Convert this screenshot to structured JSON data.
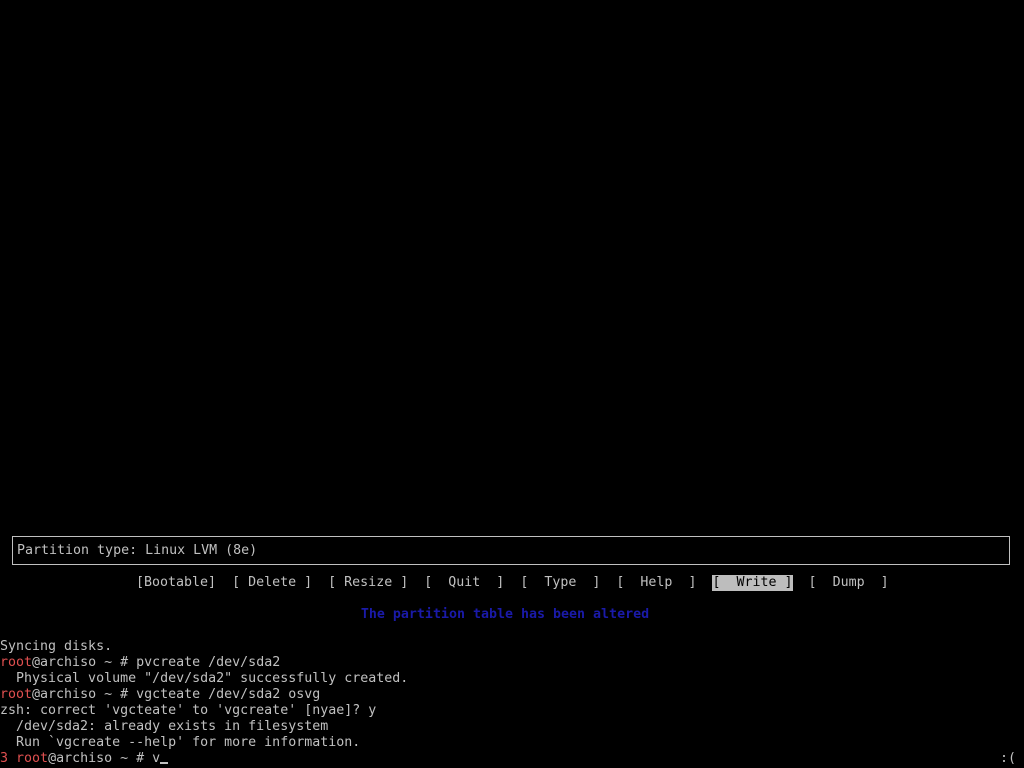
{
  "colors": {
    "background": "#000000",
    "foreground": "#c0c0c0",
    "root_user": "#e05050",
    "status_message": "#1a1aa8",
    "selected_button_bg": "#bdbdbd",
    "selected_button_fg": "#000000"
  },
  "cfdisk": {
    "partition_info": "Partition type: Linux LVM (8e)",
    "menu": [
      {
        "label": "[Bootable]",
        "selected": false
      },
      {
        "label": "[ Delete ]",
        "selected": false
      },
      {
        "label": "[ Resize ]",
        "selected": false
      },
      {
        "label": "[  Quit  ]",
        "selected": false
      },
      {
        "label": "[  Type  ]",
        "selected": false
      },
      {
        "label": "[  Help  ]",
        "selected": false
      },
      {
        "label": "[  Write ]",
        "selected": true
      },
      {
        "label": "[  Dump  ]",
        "selected": false
      }
    ],
    "status_message": "The partition table has been altered"
  },
  "terminal": {
    "syncing": "Syncing disks.",
    "prompt_user": "root",
    "prompt_host": "@archiso ~ # ",
    "cmd1": "pvcreate /dev/sda2",
    "out1": "  Physical volume \"/dev/sda2\" successfully created.",
    "cmd2": "vgcteate /dev/sda2 osvg",
    "out2": "zsh: correct 'vgcteate' to 'vgcreate' [nyae]? y",
    "out3": "  /dev/sda2: already exists in filesystem",
    "out4": "  Run `vgcreate --help' for more information.",
    "exit_code": "3",
    "current_input": "v",
    "right_prompt": ":("
  }
}
